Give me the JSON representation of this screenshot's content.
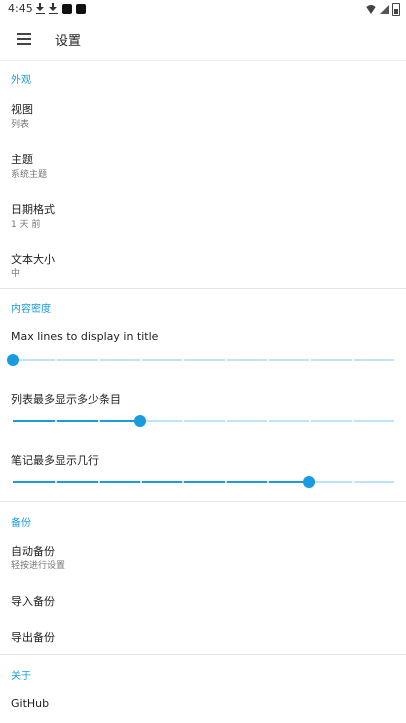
{
  "status_bar": {
    "time": "4:45"
  },
  "app_bar": {
    "title": "设置"
  },
  "sections": {
    "appearance": {
      "header": "外观",
      "view": {
        "title": "视图",
        "value": "列表"
      },
      "theme": {
        "title": "主题",
        "value": "系统主题"
      },
      "date_format": {
        "title": "日期格式",
        "value": "1 天 前"
      },
      "text_size": {
        "title": "文本大小",
        "value": "中"
      }
    },
    "content_density": {
      "header": "内容密度",
      "max_title_lines": {
        "label": "Max lines to display in title",
        "fraction": 0.0
      },
      "max_list_items": {
        "label": "列表最多显示多少条目",
        "fraction": 0.333
      },
      "max_note_lines": {
        "label": "笔记最多显示几行",
        "fraction": 0.778
      }
    },
    "backup": {
      "header": "备份",
      "auto_backup": {
        "title": "自动备份",
        "value": "轻按进行设置"
      },
      "import_backup": "导入备份",
      "export_backup": "导出备份"
    },
    "about": {
      "header": "关于",
      "github": "GitHub"
    }
  },
  "colors": {
    "accent": "#1a9be0",
    "track": "#bfe3f6",
    "divider": "#e4e4e4"
  },
  "icons": [
    "download-icon",
    "download-icon",
    "notification-square-icon",
    "notification-square-icon",
    "wifi-icon",
    "signal-icon",
    "battery-icon",
    "menu-icon"
  ]
}
